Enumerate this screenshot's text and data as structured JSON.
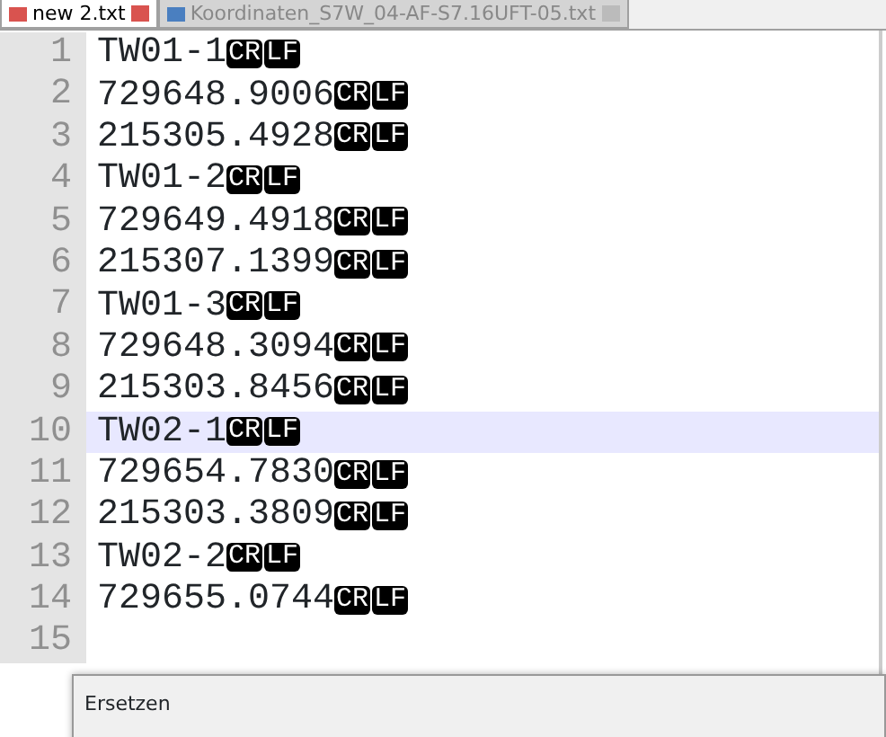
{
  "tabs": [
    {
      "label": "new 2.txt",
      "selected": true
    },
    {
      "label": "Koordinaten_S7W_04-AF-S7.16UFT-05.txt",
      "selected": false
    }
  ],
  "lines": [
    {
      "number": "1",
      "text": "TW01-1",
      "eol": [
        "CR",
        "LF"
      ],
      "current": false
    },
    {
      "number": "2",
      "text": "729648.9006",
      "eol": [
        "CR",
        "LF"
      ],
      "current": false
    },
    {
      "number": "3",
      "text": "215305.4928",
      "eol": [
        "CR",
        "LF"
      ],
      "current": false
    },
    {
      "number": "4",
      "text": "TW01-2",
      "eol": [
        "CR",
        "LF"
      ],
      "current": false
    },
    {
      "number": "5",
      "text": "729649.4918",
      "eol": [
        "CR",
        "LF"
      ],
      "current": false
    },
    {
      "number": "6",
      "text": "215307.1399",
      "eol": [
        "CR",
        "LF"
      ],
      "current": false
    },
    {
      "number": "7",
      "text": "TW01-3",
      "eol": [
        "CR",
        "LF"
      ],
      "current": false
    },
    {
      "number": "8",
      "text": "729648.3094",
      "eol": [
        "CR",
        "LF"
      ],
      "current": false
    },
    {
      "number": "9",
      "text": "215303.8456",
      "eol": [
        "CR",
        "LF"
      ],
      "current": false
    },
    {
      "number": "10",
      "text": "TW02-1",
      "eol": [
        "CR",
        "LF"
      ],
      "current": true
    },
    {
      "number": "11",
      "text": "729654.7830",
      "eol": [
        "CR",
        "LF"
      ],
      "current": false
    },
    {
      "number": "12",
      "text": "215303.3809",
      "eol": [
        "CR",
        "LF"
      ],
      "current": false
    },
    {
      "number": "13",
      "text": "TW02-2",
      "eol": [
        "CR",
        "LF"
      ],
      "current": false
    },
    {
      "number": "14",
      "text": "729655.0744",
      "eol": [
        "CR",
        "LF"
      ],
      "current": false
    },
    {
      "number": "15",
      "current": false
    }
  ],
  "dialog": {
    "title": "Ersetzen"
  }
}
